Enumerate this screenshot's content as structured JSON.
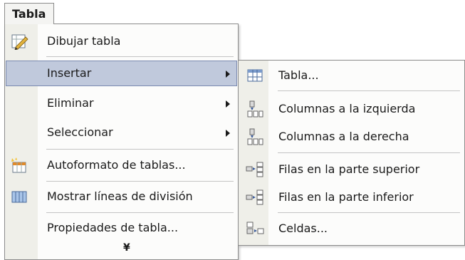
{
  "menubar": {
    "tab_label": "Tabla"
  },
  "main_menu": {
    "items": [
      {
        "label": "Dibujar tabla",
        "icon": "pencil-icon"
      },
      {
        "label": "Insertar",
        "has_submenu": true,
        "highlighted": true
      },
      {
        "label": "Eliminar",
        "has_submenu": true
      },
      {
        "label": "Seleccionar",
        "has_submenu": true
      },
      {
        "label": "Autoformato de tablas...",
        "icon": "autoformat-icon"
      },
      {
        "label": "Mostrar líneas de división",
        "icon": "gridlines-icon"
      },
      {
        "label": "Propiedades de tabla..."
      }
    ],
    "expand_glyph": "¥"
  },
  "submenu": {
    "items": [
      {
        "label": "Tabla...",
        "icon": "table-icon"
      },
      {
        "label": "Columnas a la izquierda",
        "icon": "insert-column-left-icon"
      },
      {
        "label": "Columnas a la derecha",
        "icon": "insert-column-right-icon"
      },
      {
        "label": "Filas en la parte superior",
        "icon": "insert-row-above-icon"
      },
      {
        "label": "Filas en la parte inferior",
        "icon": "insert-row-below-icon"
      },
      {
        "label": "Celdas...",
        "icon": "insert-cells-icon"
      }
    ]
  },
  "colors": {
    "highlight": "#c0c9dc",
    "gutter": "#efefe9",
    "border": "#8c8c8c"
  }
}
